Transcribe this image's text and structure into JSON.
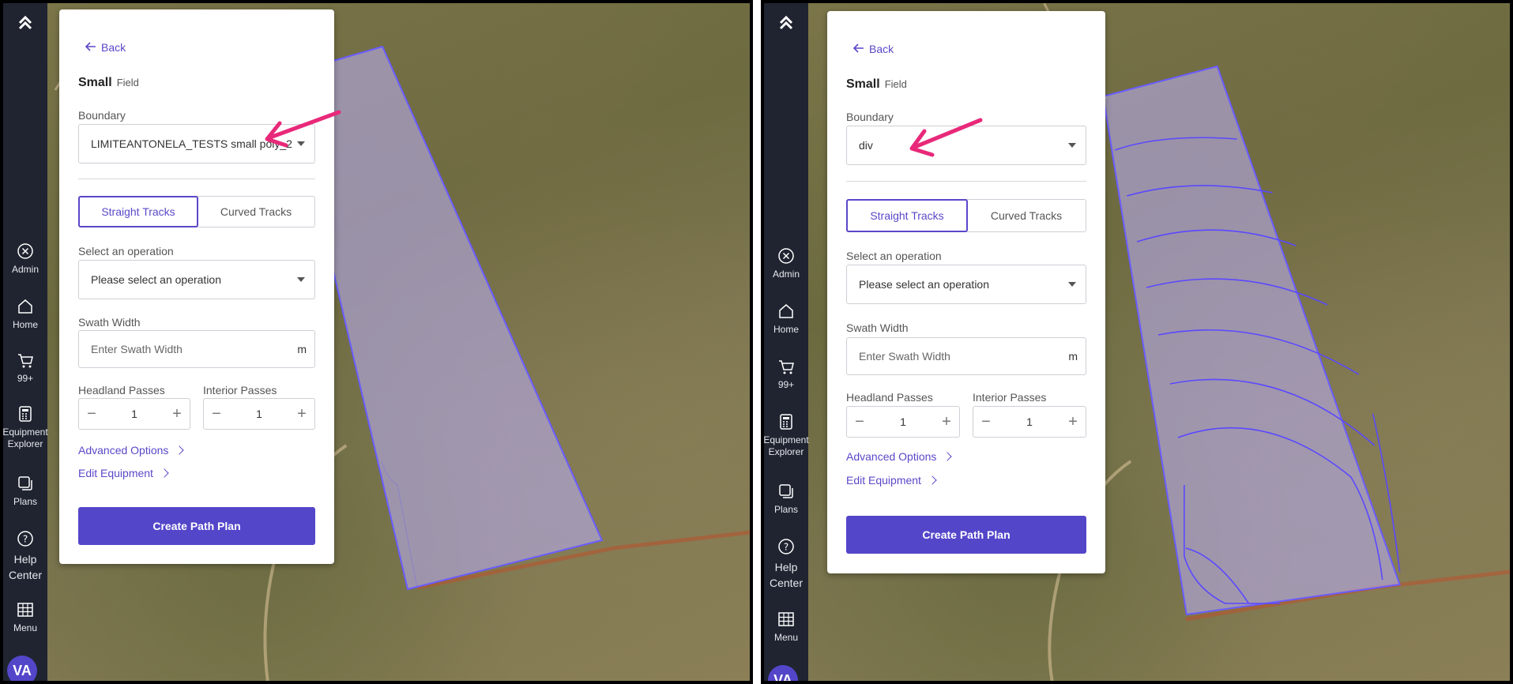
{
  "nav": {
    "admin": "Admin",
    "home": "Home",
    "cart_count": "99+",
    "equipment_1": "Equipment",
    "equipment_2": "Explorer",
    "plans": "Plans",
    "help_1": "Help",
    "help_2": "Center",
    "menu": "Menu",
    "avatar": "VA"
  },
  "left_panel": {
    "back": "Back",
    "field_name": "Small",
    "field_suffix": "Field",
    "boundary_label": "Boundary",
    "boundary_value": "LIMITEANTONELA_TESTS small poly_2",
    "tab_straight": "Straight Tracks",
    "tab_curved": "Curved Tracks",
    "operation_label": "Select an operation",
    "operation_placeholder": "Please select an operation",
    "swath_label": "Swath Width",
    "swath_placeholder": "Enter Swath Width",
    "swath_unit": "m",
    "headland_label": "Headland Passes",
    "headland_value": "1",
    "interior_label": "Interior Passes",
    "interior_value": "1",
    "advanced": "Advanced Options",
    "edit_equipment": "Edit Equipment",
    "create": "Create Path Plan"
  },
  "right_panel": {
    "back": "Back",
    "field_name": "Small",
    "field_suffix": "Field",
    "boundary_label": "Boundary",
    "boundary_value": "div",
    "tab_straight": "Straight Tracks",
    "tab_curved": "Curved Tracks",
    "operation_label": "Select an operation",
    "operation_placeholder": "Please select an operation",
    "swath_label": "Swath Width",
    "swath_placeholder": "Enter Swath Width",
    "swath_unit": "m",
    "headland_label": "Headland Passes",
    "headland_value": "1",
    "interior_label": "Interior Passes",
    "interior_value": "1",
    "advanced": "Advanced Options",
    "edit_equipment": "Edit Equipment",
    "create": "Create Path Plan"
  },
  "colors": {
    "accent": "#5446c9",
    "annotation_arrow": "#e8297a",
    "nav_bg": "#1f2430",
    "boundary_stroke": "#6a5cff"
  }
}
